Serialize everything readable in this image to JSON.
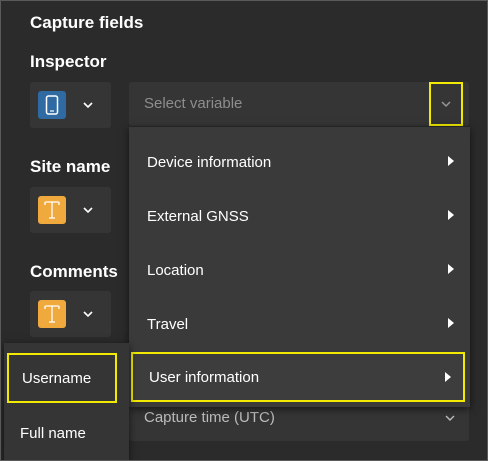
{
  "panel": {
    "title": "Capture fields"
  },
  "fields": [
    {
      "label": "Inspector",
      "icon": "mobile-device-icon",
      "icon_color": "#2f6aa3"
    },
    {
      "label": "Site name",
      "icon": "text-T-icon",
      "icon_color": "#f0a93c"
    },
    {
      "label": "Comments",
      "icon": "text-T-icon",
      "icon_color": "#f0a93c"
    }
  ],
  "variable_select": {
    "placeholder": "Select variable"
  },
  "menu": {
    "items": [
      {
        "label": "Device information"
      },
      {
        "label": "External GNSS"
      },
      {
        "label": "Location"
      },
      {
        "label": "Travel"
      },
      {
        "label": "User information",
        "highlighted": true
      }
    ]
  },
  "submenu": {
    "items": [
      {
        "label": "Username",
        "highlighted": true
      },
      {
        "label": "Full name"
      }
    ]
  },
  "bottom_select": {
    "value": "Capture time (UTC)"
  },
  "colors": {
    "highlight": "#f2ea00",
    "background": "#2b2b2b",
    "menu": "#3a3a3a"
  }
}
